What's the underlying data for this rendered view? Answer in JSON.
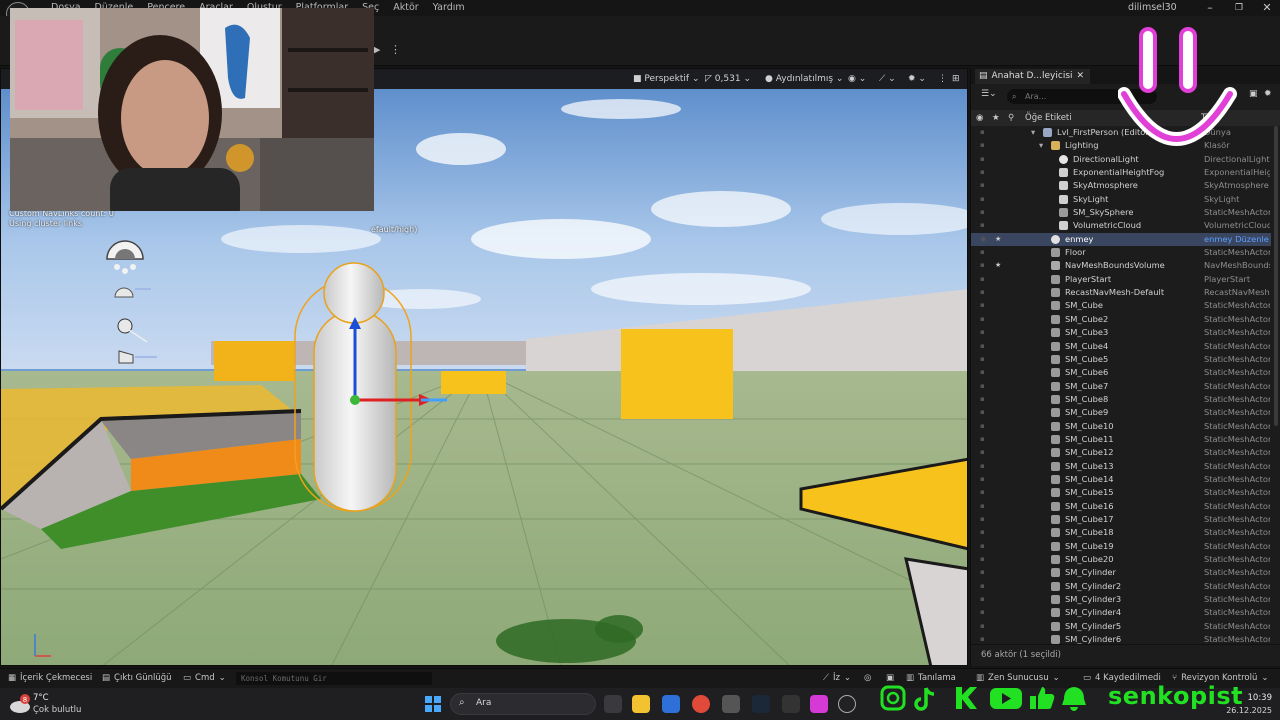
{
  "menu": {
    "items": [
      "Dosya",
      "Düzenle",
      "Pencere",
      "Araçlar",
      "Oluştur",
      "Platformlar",
      "Seç",
      "Aktör",
      "Yardım"
    ],
    "user": "dilimsel30"
  },
  "viewport": {
    "perspective": "Perspektif",
    "fov": "0,531",
    "lit_mode": "Aydınlatılmış",
    "overlay_right": "efault/high)",
    "overlay_lines": [
      "Custom NavLinks count: 0",
      "Using cluster links"
    ]
  },
  "outliner": {
    "tab_title": "Anahat D...leyicisi",
    "search_placeholder": "Ara...",
    "col_label": "Öğe Etiketi",
    "col_type": "Tür",
    "rows": [
      {
        "name": "Lvl_FirstPerson (Editor)",
        "type": "Dünya",
        "indent": 0,
        "icon": "world"
      },
      {
        "name": "Lighting",
        "type": "Klasör",
        "indent": 1,
        "icon": "folder"
      },
      {
        "name": "DirectionalLight",
        "type": "DirectionalLight",
        "indent": 2,
        "icon": "sun"
      },
      {
        "name": "ExponentialHeightFog",
        "type": "ExponentialHeigh",
        "indent": 2,
        "icon": "fog"
      },
      {
        "name": "SkyAtmosphere",
        "type": "SkyAtmosphere",
        "indent": 2,
        "icon": "sky"
      },
      {
        "name": "SkyLight",
        "type": "SkyLight",
        "indent": 2,
        "icon": "skylight"
      },
      {
        "name": "SM_SkySphere",
        "type": "StaticMeshActor",
        "indent": 2,
        "icon": "mesh"
      },
      {
        "name": "VolumetricCloud",
        "type": "VolumetricCloud",
        "indent": 2,
        "icon": "cloud"
      },
      {
        "name": "enmey",
        "type": "enmey Düzenle",
        "indent": 1,
        "icon": "pawn",
        "selected": true
      },
      {
        "name": "Floor",
        "type": "StaticMeshActor",
        "indent": 1,
        "icon": "mesh"
      },
      {
        "name": "NavMeshBoundsVolume",
        "type": "NavMeshBounds",
        "indent": 1,
        "icon": "volume"
      },
      {
        "name": "PlayerStart",
        "type": "PlayerStart",
        "indent": 1,
        "icon": "mesh"
      },
      {
        "name": "RecastNavMesh-Default",
        "type": "RecastNavMesh",
        "indent": 1,
        "icon": "mesh"
      },
      {
        "name": "SM_Cube",
        "type": "StaticMeshActor",
        "indent": 1,
        "icon": "mesh"
      },
      {
        "name": "SM_Cube2",
        "type": "StaticMeshActor",
        "indent": 1,
        "icon": "mesh"
      },
      {
        "name": "SM_Cube3",
        "type": "StaticMeshActor",
        "indent": 1,
        "icon": "mesh"
      },
      {
        "name": "SM_Cube4",
        "type": "StaticMeshActor",
        "indent": 1,
        "icon": "mesh"
      },
      {
        "name": "SM_Cube5",
        "type": "StaticMeshActor",
        "indent": 1,
        "icon": "mesh"
      },
      {
        "name": "SM_Cube6",
        "type": "StaticMeshActor",
        "indent": 1,
        "icon": "mesh"
      },
      {
        "name": "SM_Cube7",
        "type": "StaticMeshActor",
        "indent": 1,
        "icon": "mesh"
      },
      {
        "name": "SM_Cube8",
        "type": "StaticMeshActor",
        "indent": 1,
        "icon": "mesh"
      },
      {
        "name": "SM_Cube9",
        "type": "StaticMeshActor",
        "indent": 1,
        "icon": "mesh"
      },
      {
        "name": "SM_Cube10",
        "type": "StaticMeshActor",
        "indent": 1,
        "icon": "mesh"
      },
      {
        "name": "SM_Cube11",
        "type": "StaticMeshActor",
        "indent": 1,
        "icon": "mesh"
      },
      {
        "name": "SM_Cube12",
        "type": "StaticMeshActor",
        "indent": 1,
        "icon": "mesh"
      },
      {
        "name": "SM_Cube13",
        "type": "StaticMeshActor",
        "indent": 1,
        "icon": "mesh"
      },
      {
        "name": "SM_Cube14",
        "type": "StaticMeshActor",
        "indent": 1,
        "icon": "mesh"
      },
      {
        "name": "SM_Cube15",
        "type": "StaticMeshActor",
        "indent": 1,
        "icon": "mesh"
      },
      {
        "name": "SM_Cube16",
        "type": "StaticMeshActor",
        "indent": 1,
        "icon": "mesh"
      },
      {
        "name": "SM_Cube17",
        "type": "StaticMeshActor",
        "indent": 1,
        "icon": "mesh"
      },
      {
        "name": "SM_Cube18",
        "type": "StaticMeshActor",
        "indent": 1,
        "icon": "mesh"
      },
      {
        "name": "SM_Cube19",
        "type": "StaticMeshActor",
        "indent": 1,
        "icon": "mesh"
      },
      {
        "name": "SM_Cube20",
        "type": "StaticMeshActor",
        "indent": 1,
        "icon": "mesh"
      },
      {
        "name": "SM_Cylinder",
        "type": "StaticMeshActor",
        "indent": 1,
        "icon": "mesh"
      },
      {
        "name": "SM_Cylinder2",
        "type": "StaticMeshActor",
        "indent": 1,
        "icon": "mesh"
      },
      {
        "name": "SM_Cylinder3",
        "type": "StaticMeshActor",
        "indent": 1,
        "icon": "mesh"
      },
      {
        "name": "SM_Cylinder4",
        "type": "StaticMeshActor",
        "indent": 1,
        "icon": "mesh"
      },
      {
        "name": "SM_Cylinder5",
        "type": "StaticMeshActor",
        "indent": 1,
        "icon": "mesh"
      },
      {
        "name": "SM_Cylinder6",
        "type": "StaticMeshActor",
        "indent": 1,
        "icon": "mesh"
      }
    ],
    "footer": "66 aktör (1 seçildi)"
  },
  "statusbar": {
    "content_drawer": "İçerik Çekmecesi",
    "output_log": "Çıktı Günlüğü",
    "cmd": "Cmd",
    "console_placeholder": "Konsol Komutunu Gir",
    "trace": "İz",
    "derived_data": "Tanılama",
    "zen": "Zen Sunucusu",
    "saved": "4 Kaydedilmedi",
    "revision": "Revizyon Kontrolü"
  },
  "taskbar": {
    "weather_badge": "8",
    "temperature": "7°C",
    "weather_desc": "Çok bulutlu",
    "search": "Ara",
    "time": "10:39",
    "date": "26.12.2025"
  },
  "overlay": {
    "brand": "senkopist"
  },
  "colors": {
    "accent_select": "#3a4660",
    "type_selected": "#5aa0ff",
    "brand_green": "#22e022",
    "smile_pink": "#e040d8"
  }
}
